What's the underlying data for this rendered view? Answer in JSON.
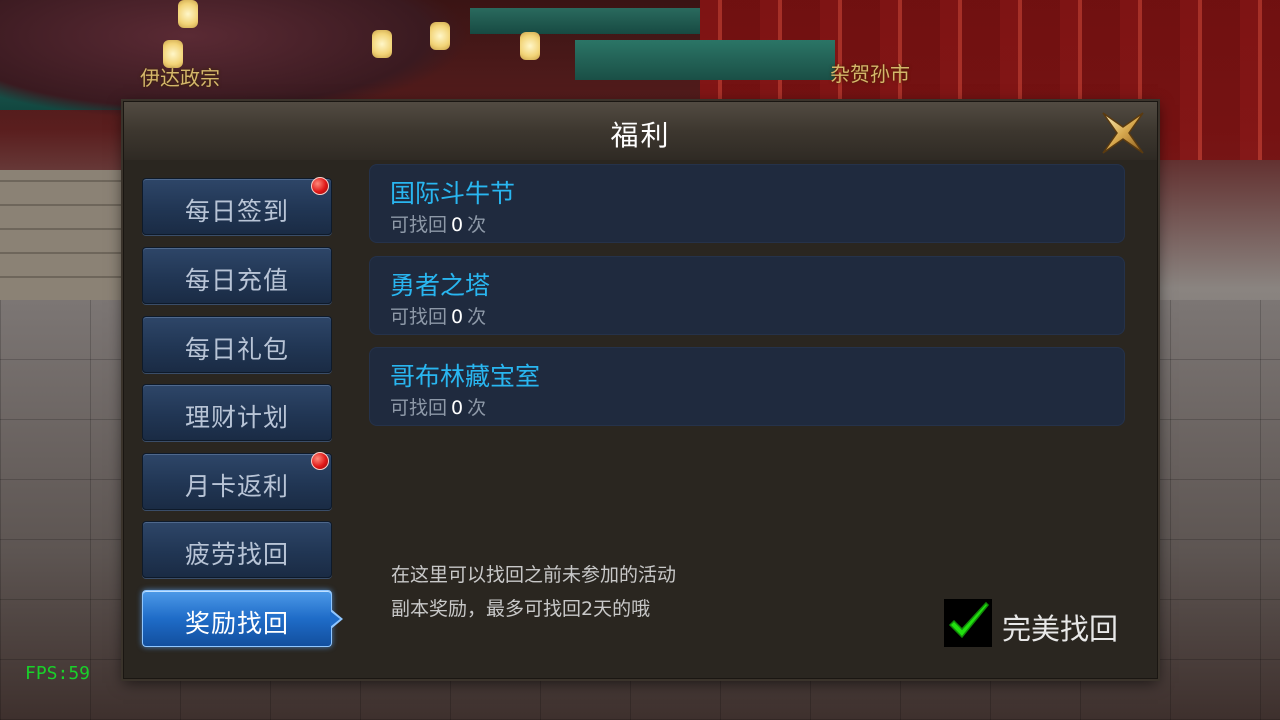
{
  "scene": {
    "labels": [
      "伊达政宗",
      "杂贺孙市"
    ]
  },
  "panel": {
    "title": "福利",
    "close_icon": "close-x-icon"
  },
  "sidebar": {
    "items": [
      {
        "label": "每日签到",
        "badge": true,
        "active": false
      },
      {
        "label": "每日充值",
        "badge": false,
        "active": false
      },
      {
        "label": "每日礼包",
        "badge": false,
        "active": false
      },
      {
        "label": "理财计划",
        "badge": false,
        "active": false
      },
      {
        "label": "月卡返利",
        "badge": true,
        "active": false
      },
      {
        "label": "疲劳找回",
        "badge": false,
        "active": false
      },
      {
        "label": "奖励找回",
        "badge": false,
        "active": true
      }
    ]
  },
  "recover_list": [
    {
      "name": "国际斗牛节",
      "prefix": "可找回",
      "count": "0",
      "suffix": "次"
    },
    {
      "name": "勇者之塔",
      "prefix": "可找回",
      "count": "0",
      "suffix": "次"
    },
    {
      "name": "哥布林藏宝室",
      "prefix": "可找回",
      "count": "0",
      "suffix": "次"
    }
  ],
  "hint": {
    "line1": "在这里可以找回之前未参加的活动",
    "line2": "副本奖励，最多可找回2天的哦"
  },
  "perfect_recover": {
    "label": "完美找回",
    "checked": true,
    "check_color": "#22e010"
  },
  "fps": "FPS:59"
}
